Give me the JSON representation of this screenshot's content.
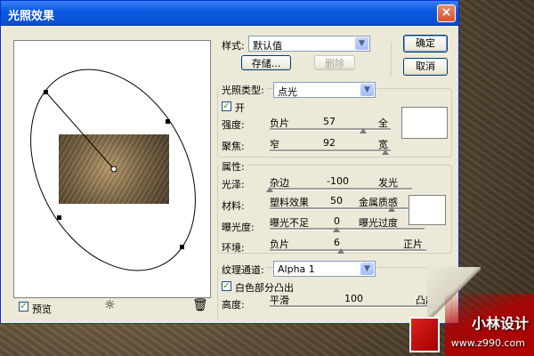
{
  "window": {
    "title": "光照效果",
    "close_icon": "×"
  },
  "style": {
    "label": "样式:",
    "value": "默认值",
    "save_label": "存储...",
    "delete_label": "删除"
  },
  "buttons": {
    "ok": "确定",
    "cancel": "取消"
  },
  "light_type": {
    "label": "光照类型:",
    "value": "点光",
    "on_label": "开",
    "on_checked": true,
    "intensity": {
      "label": "强度:",
      "left": "负片",
      "value": "57",
      "right": "全"
    },
    "focus": {
      "label": "聚焦:",
      "left": "窄",
      "value": "92",
      "right": "宽"
    }
  },
  "properties": {
    "title": "属性:",
    "gloss": {
      "label": "光泽:",
      "left": "杂边",
      "value": "-100",
      "right": "发光"
    },
    "material": {
      "label": "材料:",
      "left": "塑料效果",
      "value": "50",
      "right": "金属质感"
    },
    "exposure": {
      "label": "曝光度:",
      "left": "曝光不足",
      "value": "0",
      "right": "曝光过度"
    },
    "ambience": {
      "label": "环境:",
      "left": "负片",
      "value": "6",
      "right": "正片"
    }
  },
  "texture": {
    "label": "纹理通道:",
    "value": "Alpha 1",
    "white_high_label": "白色部分凸出",
    "white_high_checked": true,
    "height": {
      "label": "高度:",
      "left": "平滑",
      "value": "100",
      "right": "凸起"
    }
  },
  "preview": {
    "label": "预览",
    "checked": true,
    "bulb_icon": "☼",
    "trash_icon": "🗑"
  },
  "watermark": {
    "name": "小林设计",
    "url": "www.z990.com"
  },
  "colors": {
    "title_bar": "#0a5ae0",
    "dialog_bg": "#ece9d8",
    "close_button": "#d6502c"
  }
}
